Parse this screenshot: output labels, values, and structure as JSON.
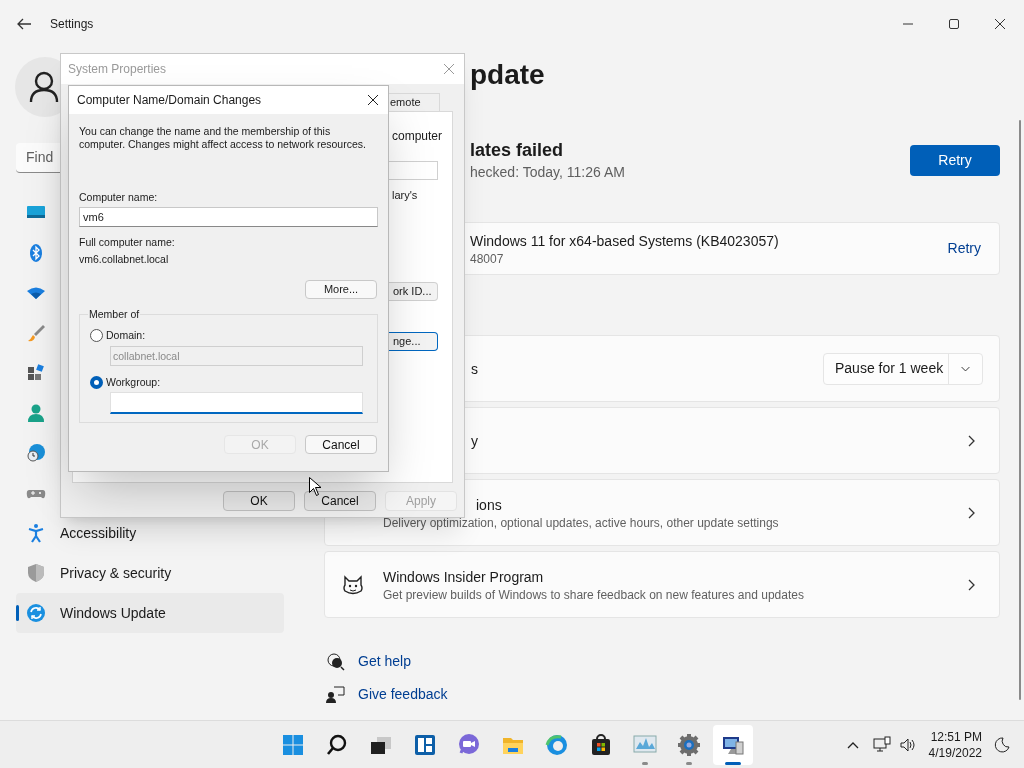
{
  "settings": {
    "title": "Settings",
    "search": {
      "placeholder": "Find"
    },
    "nav": [
      {
        "kind": "system",
        "selected": false
      },
      {
        "kind": "bluetooth",
        "selected": false
      },
      {
        "kind": "network",
        "selected": false
      },
      {
        "kind": "personalization",
        "selected": false
      },
      {
        "kind": "apps",
        "selected": false
      },
      {
        "kind": "accounts",
        "selected": false
      },
      {
        "kind": "time",
        "selected": false
      },
      {
        "kind": "gaming",
        "selected": false
      },
      {
        "kind": "accessibility",
        "label": "Accessibility",
        "selected": false
      },
      {
        "kind": "privacy",
        "label": "Privacy & security",
        "selected": false
      },
      {
        "kind": "update",
        "label": "Windows Update",
        "selected": true
      }
    ],
    "page_title": "pdate",
    "status": {
      "title": "lates failed",
      "subtitle": "hecked: Today, 11:26 AM",
      "button": "Retry"
    },
    "update_item": {
      "name": "Windows 11 for x64-based Systems (KB4023057)",
      "detail": "48007",
      "action": "Retry"
    },
    "cards": [
      {
        "title": "s",
        "title_clipped": true,
        "dropdown": "Pause for 1 week"
      },
      {
        "title": "y",
        "title_clipped": true
      },
      {
        "title": "ions",
        "title_clipped": true,
        "subtitle": "Delivery optimization, optional updates, active hours, other update settings"
      },
      {
        "title": "Windows Insider Program",
        "title_clipped": false,
        "subtitle": "Get preview builds of Windows to share feedback on new features and updates"
      }
    ],
    "links": [
      {
        "kind": "help",
        "label": "Get help"
      },
      {
        "kind": "feedback",
        "label": "Give feedback"
      }
    ]
  },
  "system_properties": {
    "title": "System Properties",
    "tabs": [
      {
        "label": "emote",
        "selected": false
      }
    ],
    "texts": [
      "computer",
      "lary's"
    ],
    "panel_buttons": [
      {
        "label": "ork ID...",
        "focused": false
      },
      {
        "label": "nge...",
        "focused": true
      }
    ],
    "buttons": [
      {
        "label": "OK",
        "disabled": false
      },
      {
        "label": "Cancel",
        "disabled": false
      },
      {
        "label": "Apply",
        "disabled": true
      }
    ]
  },
  "computer_name_dialog": {
    "title": "Computer Name/Domain Changes",
    "description": "You can change the name and the membership of this computer. Changes might affect access to network resources.",
    "computer_name_label": "Computer name:",
    "computer_name": {
      "value": "vm6"
    },
    "full_name_label": "Full computer name:",
    "full_name": "vm6.collabnet.local",
    "more_button": "More...",
    "member_of": {
      "legend": "Member of",
      "options": [
        {
          "label": "Domain:",
          "selected": false,
          "field": {
            "value": "collabnet.local",
            "disabled": true,
            "focused": false
          }
        },
        {
          "label": "Workgroup:",
          "selected": true,
          "field": {
            "disabled": false,
            "focused": true
          }
        }
      ]
    },
    "buttons": [
      {
        "label": "OK",
        "disabled": true
      },
      {
        "label": "Cancel",
        "disabled": false
      }
    ]
  },
  "taskbar": {
    "apps": [
      {
        "kind": "start",
        "open": false,
        "active": false
      },
      {
        "kind": "search",
        "open": false,
        "active": false
      },
      {
        "kind": "taskview",
        "open": false,
        "active": false
      },
      {
        "kind": "widgets",
        "open": false,
        "active": false
      },
      {
        "kind": "chat",
        "open": false,
        "active": false
      },
      {
        "kind": "explorer",
        "open": false,
        "active": false
      },
      {
        "kind": "edge",
        "open": false,
        "active": false
      },
      {
        "kind": "store",
        "open": false,
        "active": false
      },
      {
        "kind": "monitor",
        "open": true,
        "active": false
      },
      {
        "kind": "settings",
        "open": true,
        "active": false
      },
      {
        "kind": "system",
        "open": true,
        "active": true
      }
    ],
    "time": "12:51 PM",
    "date": "4/19/2022"
  }
}
